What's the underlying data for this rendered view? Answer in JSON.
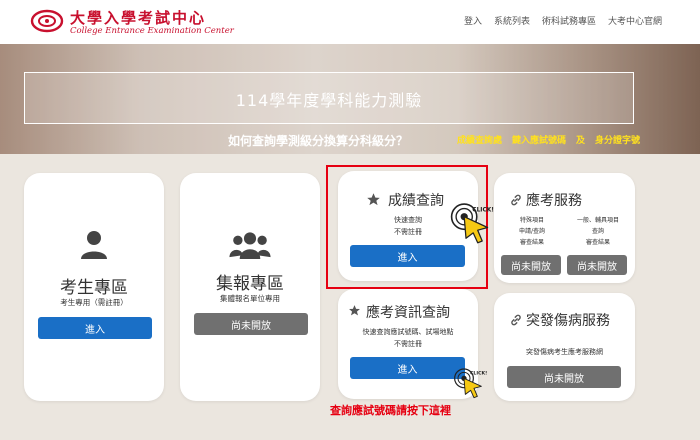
{
  "header": {
    "logo_zh": "大學入學考試中心",
    "logo_en": "College Entrance Examination Center",
    "nav": [
      "登入",
      "系統列表",
      "術科試務專區",
      "大考中心官網"
    ]
  },
  "hero": {
    "title": "114學年度學科能力測驗",
    "question": "如何查詢學測級分換算分科級分？",
    "links": [
      "成績查詢處",
      "鍵入應試號碼",
      "及",
      "身分證字號"
    ]
  },
  "cards": {
    "student": {
      "title": "考生專區",
      "subtitle": "考生專用（需註冊）",
      "button": "進入"
    },
    "group": {
      "title": "集報專區",
      "subtitle": "集體報名單位專用",
      "button": "尚未開放"
    },
    "score": {
      "title": "成績查詢",
      "line1": "快速查詢",
      "line2": "不需註冊",
      "button": "進入"
    },
    "exam_info": {
      "title": "應考資訊查詢",
      "line1": "快速查詢應試號碼、試場地點",
      "line2": "不需註冊",
      "button": "進入"
    },
    "service": {
      "title": "應考服務",
      "col1": [
        "特殊項目",
        "申請/查詢",
        "審查結果"
      ],
      "col2": [
        "一般、輔具項目",
        "查詢",
        "審查結果"
      ],
      "button1": "尚未開放",
      "button2": "尚未開放"
    },
    "illness": {
      "title": "突發傷病服務",
      "subtitle": "突發傷病考生應考服務網",
      "button": "尚未開放"
    }
  },
  "annotations": {
    "click": "CLICK!",
    "note": "查詢應試號碼請按下這裡"
  },
  "colors": {
    "brand_red": "#c8102e",
    "button_blue": "#1a6fc6",
    "button_gray": "#707070",
    "highlight_red": "#e60012",
    "hero_yellow": "#ffe11f"
  }
}
